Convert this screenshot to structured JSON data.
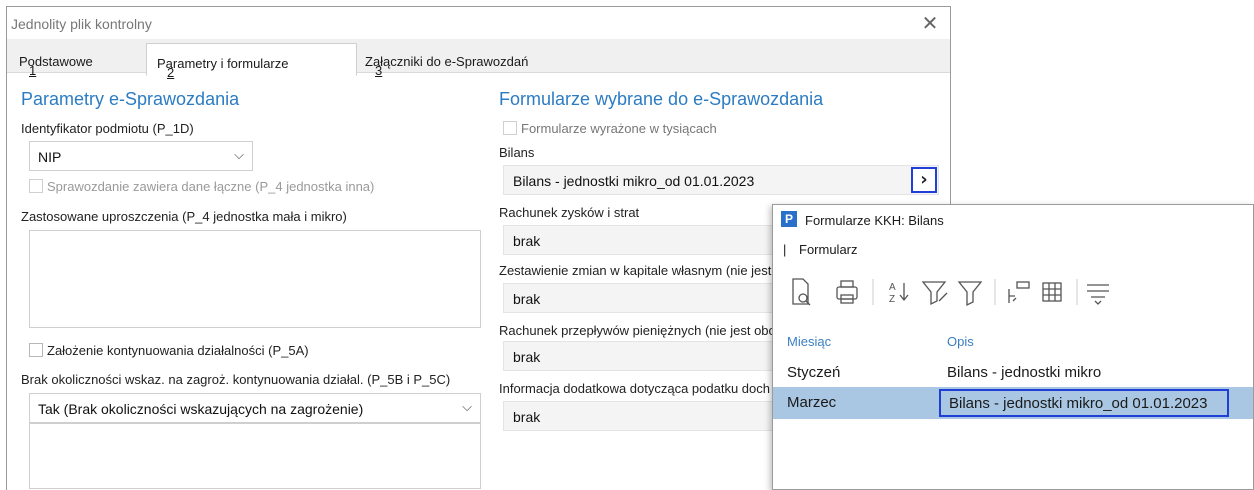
{
  "window": {
    "title": "Jednolity plik kontrolny",
    "close_glyph": "✕",
    "tabs": [
      {
        "num": "1",
        "label": " Podstawowe"
      },
      {
        "num": "2",
        "label": " Parametry i formularze"
      },
      {
        "num": "3",
        "label": " Załączniki do e-Sprawozdań"
      }
    ]
  },
  "left": {
    "heading": "Parametry e-Sprawozdania",
    "identifier_label": "Identyfikator podmiotu (P_1D)",
    "identifier_value": "NIP",
    "combined_data_label": "Sprawozdanie zawiera dane łączne (P_4 jednostka inna)",
    "simplifications_label": "Zastosowane uproszczenia (P_4  jednostka mała i mikro)",
    "going_concern_label": "Założenie kontynuowania działalności (P_5A)",
    "threat_label": "Brak okoliczności wskaz. na zagroż. kontynuowania działal. (P_5B i P_5C)",
    "threat_value": "Tak (Brak okoliczności wskazujących na zagrożenie)"
  },
  "right": {
    "heading": "Formularze wybrane do e-Sprawozdania",
    "thousands_label": "Formularze wyrażone w tysiącach",
    "bilans_label": "Bilans",
    "bilans_value": "Bilans - jednostki mikro_od 01.01.2023",
    "rzis_label": "Rachunek zysków i strat",
    "rzis_value": "brak",
    "zzk_label": "Zestawienie zmian w kapitale własnym (nie jest",
    "zzk_value": "brak",
    "rpp_label": "Rachunek przepływów pieniężnych (nie jest obo",
    "rpp_value": "brak",
    "info_label": "Informacja dodatkowa dotycząca podatku doch",
    "info_value": "brak",
    "more_glyph": "›"
  },
  "popup": {
    "app_icon_letter": "P",
    "title": "Formularze KKH: Bilans",
    "menu_separator": "|",
    "menu_label": "Formularz",
    "columns": [
      "Miesiąc",
      "Opis"
    ],
    "rows": [
      {
        "month": "Styczeń",
        "desc": "Bilans - jednostki mikro"
      },
      {
        "month": "Marzec",
        "desc": "Bilans - jednostki mikro_od 01.01.2023"
      }
    ],
    "selected_row": 1
  },
  "colors": {
    "accent_blue": "#2c7cc4",
    "highlight_border": "#1f3fd6",
    "selected_row": "#a9c7e3",
    "app_icon_bg": "#2a6fc9"
  }
}
